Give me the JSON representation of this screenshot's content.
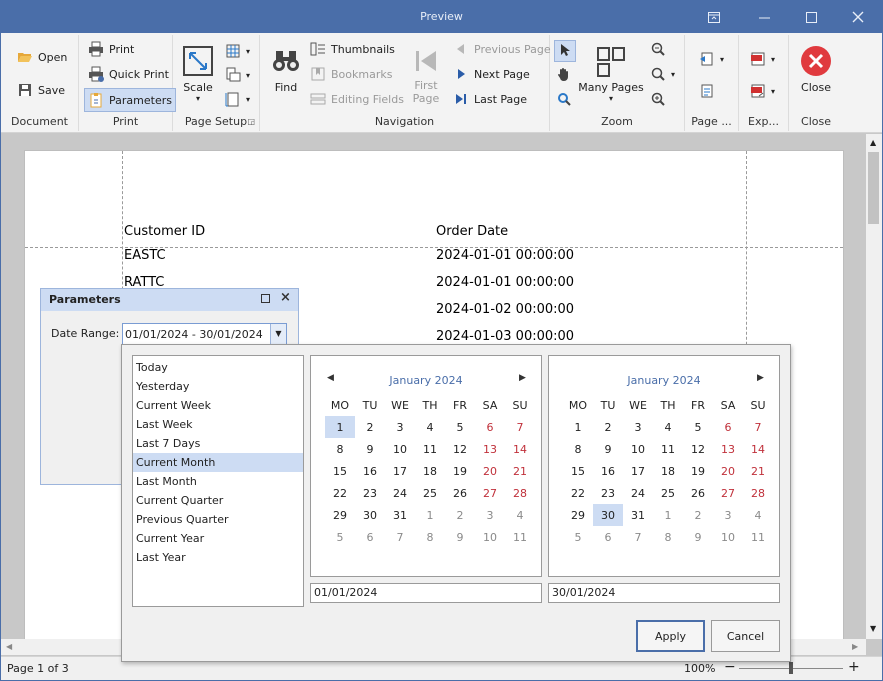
{
  "window": {
    "title": "Preview"
  },
  "ribbon": {
    "document": {
      "open": "Open",
      "save": "Save",
      "caption": "Document"
    },
    "print": {
      "print": "Print",
      "quick_print": "Quick Print",
      "parameters": "Parameters",
      "caption": "Print"
    },
    "page_setup": {
      "scale": "Scale",
      "caption": "Page Setup"
    },
    "navigation": {
      "find": "Find",
      "thumbnails": "Thumbnails",
      "bookmarks": "Bookmarks",
      "editing_fields": "Editing Fields",
      "first_page": "First Page",
      "previous_page": "Previous Page",
      "next_page": "Next Page",
      "last_page": "Last Page",
      "caption": "Navigation"
    },
    "zoom": {
      "many_pages": "Many Pages",
      "caption": "Zoom"
    },
    "page_group": {
      "caption": "Page ..."
    },
    "export": {
      "caption": "Exp..."
    },
    "close": {
      "close": "Close",
      "caption": "Close"
    }
  },
  "report": {
    "headers": [
      "Customer ID",
      "Order Date"
    ],
    "rows": [
      [
        "EASTC",
        "2024-01-01 00:00:00"
      ],
      [
        "RATTC",
        "2024-01-01 00:00:00"
      ],
      [
        "",
        "2024-01-02 00:00:00"
      ],
      [
        "",
        "2024-01-03 00:00:00"
      ]
    ]
  },
  "params": {
    "title": "Parameters",
    "date_range_label": "Date Range:",
    "date_range_value": "01/01/2024 - 30/01/2024"
  },
  "popup": {
    "ranges": [
      "Today",
      "Yesterday",
      "Current Week",
      "Last Week",
      "Last 7 Days",
      "Current Month",
      "Last Month",
      "Current Quarter",
      "Previous Quarter",
      "Current Year",
      "Last Year"
    ],
    "active_range": "Current Month",
    "weekdays": [
      "MO",
      "TU",
      "WE",
      "TH",
      "FR",
      "SA",
      "SU"
    ],
    "left_calendar": {
      "month": "January 2024",
      "weeks": [
        [
          "1",
          "2",
          "3",
          "4",
          "5",
          "6",
          "7"
        ],
        [
          "8",
          "9",
          "10",
          "11",
          "12",
          "13",
          "14"
        ],
        [
          "15",
          "16",
          "17",
          "18",
          "19",
          "20",
          "21"
        ],
        [
          "22",
          "23",
          "24",
          "25",
          "26",
          "27",
          "28"
        ],
        [
          "29",
          "30",
          "31",
          "1",
          "2",
          "3",
          "4"
        ],
        [
          "5",
          "6",
          "7",
          "8",
          "9",
          "10",
          "11"
        ]
      ],
      "selected": "1"
    },
    "right_calendar": {
      "month": "January 2024",
      "weeks": [
        [
          "1",
          "2",
          "3",
          "4",
          "5",
          "6",
          "7"
        ],
        [
          "8",
          "9",
          "10",
          "11",
          "12",
          "13",
          "14"
        ],
        [
          "15",
          "16",
          "17",
          "18",
          "19",
          "20",
          "21"
        ],
        [
          "22",
          "23",
          "24",
          "25",
          "26",
          "27",
          "28"
        ],
        [
          "29",
          "30",
          "31",
          "1",
          "2",
          "3",
          "4"
        ],
        [
          "5",
          "6",
          "7",
          "8",
          "9",
          "10",
          "11"
        ]
      ],
      "selected": "30"
    },
    "start_date": "01/01/2024",
    "end_date": "30/01/2024",
    "apply": "Apply",
    "cancel": "Cancel"
  },
  "status": {
    "page_info": "Page 1 of 3",
    "zoom": "100%",
    "zoom_level": 0.5
  },
  "colors": {
    "accent": "#4a6ea9",
    "selection": "#cddcf3",
    "weekend": "#c0303a",
    "close_red": "#e03a3e"
  }
}
